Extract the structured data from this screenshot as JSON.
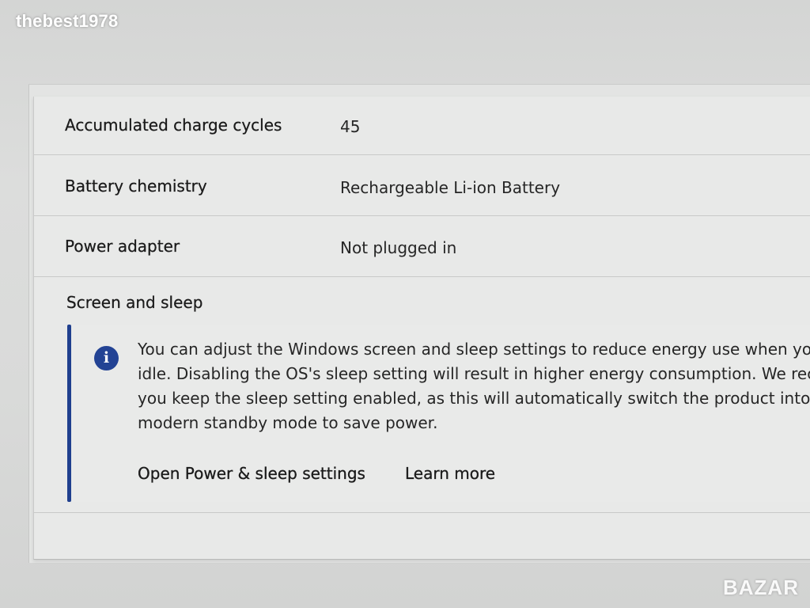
{
  "watermark": {
    "text": "thebest1978"
  },
  "brand_logo": {
    "text": "BAZAR"
  },
  "battery_info": {
    "rows": [
      {
        "label": "Accumulated charge cycles",
        "value": "45"
      },
      {
        "label": "Battery chemistry",
        "value": "Rechargeable Li-ion Battery"
      },
      {
        "label": "Power adapter",
        "value": "Not plugged in"
      }
    ]
  },
  "screen_sleep": {
    "title": "Screen and sleep",
    "icon": "info-icon",
    "icon_glyph": "i",
    "accent_color": "#1f3f8e",
    "message_lines": [
      "You can adjust the Windows screen and sleep settings to reduce energy use when you",
      "idle. Disabling the OS's sleep setting will result in higher energy consumption. We reco",
      "you keep the sleep setting enabled, as this will automatically switch the product into s",
      "modern standby mode to save power."
    ],
    "open_settings_link": "Open Power & sleep settings",
    "learn_more_link": "Learn more"
  }
}
